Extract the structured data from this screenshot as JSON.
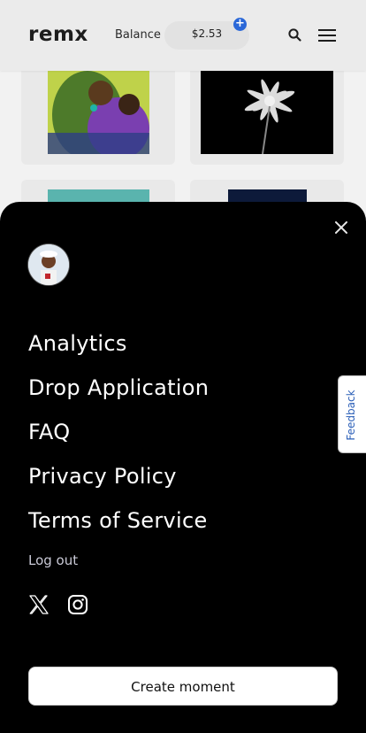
{
  "header": {
    "logo": "remx",
    "balance_label": "Balance",
    "balance_value": "$2.53",
    "add_funds_symbol": "+",
    "search_icon": "search-icon",
    "menu_icon": "hamburger-menu-icon"
  },
  "background_cards": [
    {
      "art": "painting of an embracing couple"
    },
    {
      "art": "white flower on black"
    },
    {
      "art": "teal artwork"
    },
    {
      "art": "dark blue artwork"
    }
  ],
  "drawer": {
    "close_icon": "close-icon",
    "avatar_alt": "user avatar",
    "menu_items": [
      {
        "label": "Analytics"
      },
      {
        "label": "Drop Application"
      },
      {
        "label": "FAQ"
      },
      {
        "label": "Privacy Policy"
      },
      {
        "label": "Terms of Service"
      }
    ],
    "logout_label": "Log out",
    "social": [
      "x-icon",
      "instagram-icon"
    ],
    "create_button_label": "Create moment"
  },
  "feedback_label": "Feedback",
  "colors": {
    "accent_blue": "#2b68d8",
    "drawer_bg": "#000000",
    "page_bg": "#f2f2f2"
  }
}
